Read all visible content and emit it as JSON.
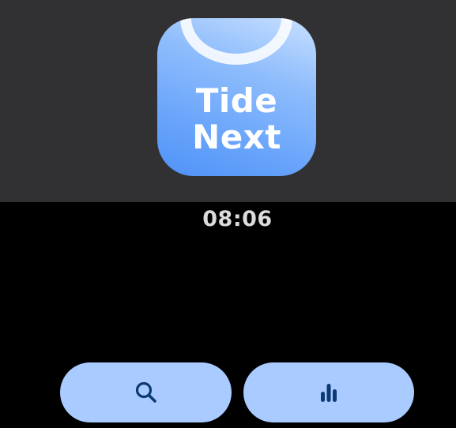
{
  "app_icon": {
    "line1": "Tide",
    "line2": "Next"
  },
  "status": {
    "time": "08:06"
  },
  "actions": [
    {
      "name": "search",
      "icon": "search-icon"
    },
    {
      "name": "stats",
      "icon": "bar-chart-icon"
    }
  ],
  "colors": {
    "top_panel": "#313133",
    "background": "#000000",
    "pill": "#a9cbff",
    "icon_glyph": "#0c3a73",
    "icon_gradient_light": "#c9e0ff",
    "icon_gradient_dark": "#4f92f7"
  }
}
